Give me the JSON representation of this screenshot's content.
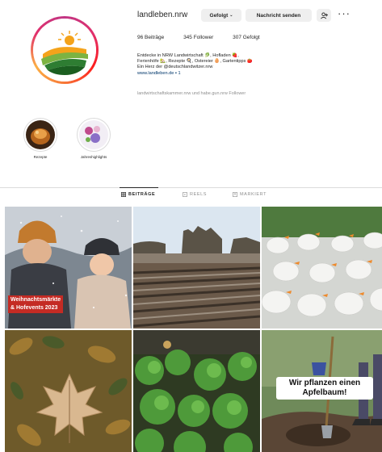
{
  "profile": {
    "username": "landleben.nrw",
    "follow_label": "Gefolgt",
    "message_label": "Nachricht senden",
    "more_label": "···",
    "stats": {
      "posts": "96 Beiträge",
      "followers": "345 Follower",
      "following": "307 Gefolgt"
    },
    "bio": [
      "Entdecke in NRW Landwirtschaft 🥬, Hofladen 🍓,",
      "Ferienhöfe 🏡, Rezepte 🍳, Ostereier 🥚, Gartentipps 🍅",
      "Ein Herz der @deutschlandwitzer.nrw",
      "www.landleben.de ▪ 1"
    ],
    "link_line_index": 3,
    "followed_by": "landwirtschaftskammer.nrw und habe.gun.nrw Follower"
  },
  "highlights": [
    {
      "label": "Rezepte"
    },
    {
      "label": "Jahreshighlights"
    }
  ],
  "tabs": [
    {
      "label": "BEITRÄGE",
      "active": true
    },
    {
      "label": "REELS",
      "active": false
    },
    {
      "label": "MARKIERT",
      "active": false
    }
  ],
  "posts": [
    {
      "overlay_lines": [
        "Weihnachtsmärkte",
        "& Hofevents 2023"
      ]
    },
    {
      "overlay_lines": []
    },
    {
      "overlay_lines": []
    },
    {
      "overlay_lines": []
    },
    {
      "overlay_lines": []
    },
    {
      "overlay_lines": [
        "Wir pflanzen einen",
        "Apfelbaum!"
      ]
    }
  ],
  "colors": {
    "accent_ring": "#e1306c",
    "overlay_red": "#c42b24",
    "link_blue": "#00376b"
  },
  "icons": [
    "logo-sun-fields-icon",
    "person-add-icon",
    "more-dots-icon",
    "grid-icon",
    "reels-icon",
    "tagged-icon"
  ]
}
